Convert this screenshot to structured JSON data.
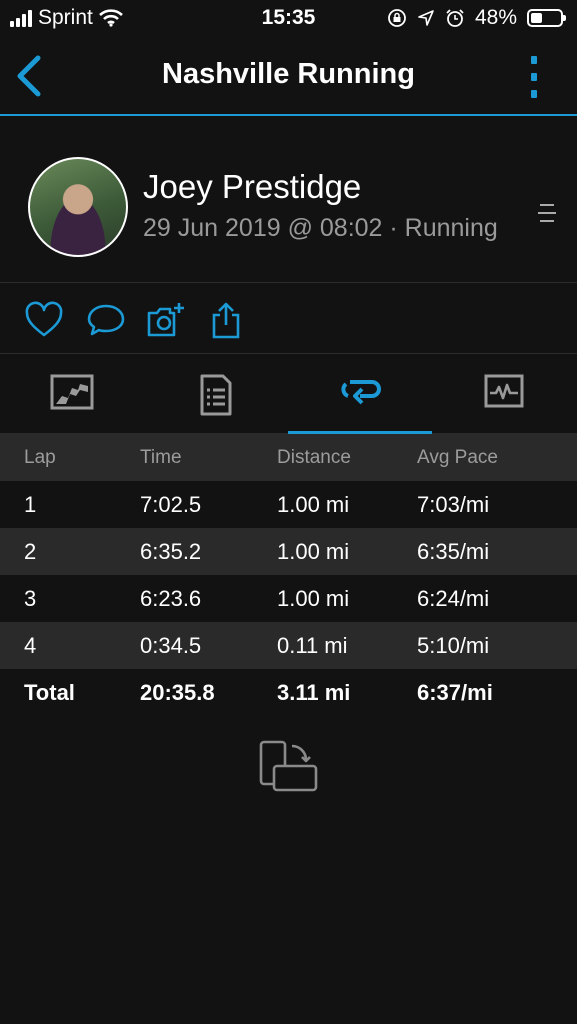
{
  "status_bar": {
    "carrier": "Sprint",
    "time": "15:35",
    "battery": "48%",
    "battery_level": 0.48
  },
  "nav": {
    "title": "Nashville Running",
    "back_icon": "chevron-left-icon",
    "more_icon": "kebab-menu-icon",
    "accent_color": "#1b9ad6"
  },
  "activity": {
    "user_name": "Joey Prestidge",
    "subtitle": "29 Jun 2019 @ 08:02 · Running"
  },
  "actions": [
    {
      "icon": "heart-icon"
    },
    {
      "icon": "comment-icon"
    },
    {
      "icon": "add-photo-icon"
    },
    {
      "icon": "share-icon"
    }
  ],
  "tabs": [
    {
      "icon": "map-icon",
      "active": false
    },
    {
      "icon": "details-icon",
      "active": false
    },
    {
      "icon": "laps-icon",
      "active": true
    },
    {
      "icon": "charts-icon",
      "active": false
    }
  ],
  "laps": {
    "headers": [
      "Lap",
      "Time",
      "Distance",
      "Avg Pace"
    ],
    "rows": [
      [
        "1",
        "7:02.5",
        "1.00 mi",
        "7:03/mi"
      ],
      [
        "2",
        "6:35.2",
        "1.00 mi",
        "6:35/mi"
      ],
      [
        "3",
        "6:23.6",
        "1.00 mi",
        "6:24/mi"
      ],
      [
        "4",
        "0:34.5",
        "0.11 mi",
        "5:10/mi"
      ]
    ],
    "total": [
      "Total",
      "20:35.8",
      "3.11 mi",
      "6:37/mi"
    ]
  }
}
